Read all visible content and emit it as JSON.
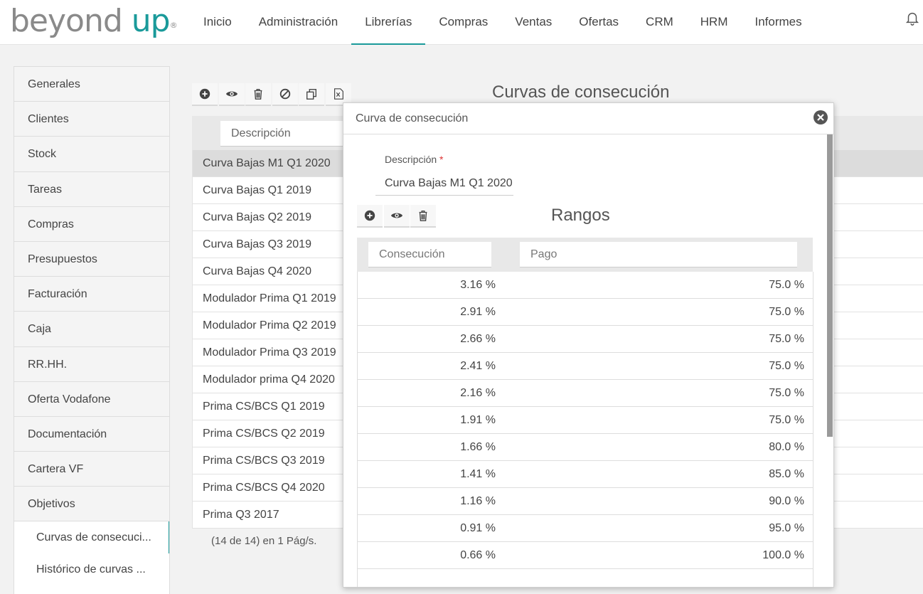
{
  "logo": {
    "part1": "beyond",
    "part2": "up",
    "reg": "®"
  },
  "nav": [
    "Inicio",
    "Administración",
    "Librerías",
    "Compras",
    "Ventas",
    "Ofertas",
    "CRM",
    "HRM",
    "Informes"
  ],
  "sidebar": {
    "items": [
      "Generales",
      "Clientes",
      "Stock",
      "Tareas",
      "Compras",
      "Presupuestos",
      "Facturación",
      "Caja",
      "RR.HH.",
      "Oferta Vodafone",
      "Documentación",
      "Cartera VF",
      "Objetivos"
    ],
    "subitems": [
      "Curvas de consecuci...",
      "Histórico de curvas ..."
    ]
  },
  "main": {
    "title": "Curvas de consecución",
    "filter_desc": "Descripción",
    "rows": [
      "Curva Bajas M1 Q1 2020",
      "Curva Bajas Q1 2019",
      "Curva Bajas Q2 2019",
      "Curva Bajas Q3 2019",
      "Curva Bajas Q4 2020",
      "Modulador Prima Q1 2019",
      "Modulador Prima Q2 2019",
      "Modulador Prima Q3 2019",
      "Modulador prima Q4 2020",
      "Prima CS/BCS Q1 2019",
      "Prima CS/BCS Q2 2019",
      "Prima CS/BCS Q3 2019",
      "Prima CS/BCS Q4 2020",
      "Prima Q3 2017"
    ],
    "pager": "(14 de 14) en 1 Pág/s."
  },
  "dialog": {
    "title": "Curva de consecución",
    "desc_label": "Descripción",
    "required_mark": "*",
    "desc_value": "Curva Bajas M1 Q1 2020",
    "rangos_title": "Rangos",
    "col1": "Consecución",
    "col2": "Pago",
    "rows": [
      {
        "c": "3.16 %",
        "p": "75.0 %"
      },
      {
        "c": "2.91 %",
        "p": "75.0 %"
      },
      {
        "c": "2.66 %",
        "p": "75.0 %"
      },
      {
        "c": "2.41 %",
        "p": "75.0 %"
      },
      {
        "c": "2.16 %",
        "p": "75.0 %"
      },
      {
        "c": "1.91 %",
        "p": "75.0 %"
      },
      {
        "c": "1.66 %",
        "p": "80.0 %"
      },
      {
        "c": "1.41 %",
        "p": "85.0 %"
      },
      {
        "c": "1.16 %",
        "p": "90.0 %"
      },
      {
        "c": "0.91 %",
        "p": "95.0 %"
      },
      {
        "c": "0.66 %",
        "p": "100.0 %"
      }
    ]
  },
  "colors": {
    "accent": "#1a9a9a",
    "logo_gray": "#8a8a8a"
  }
}
